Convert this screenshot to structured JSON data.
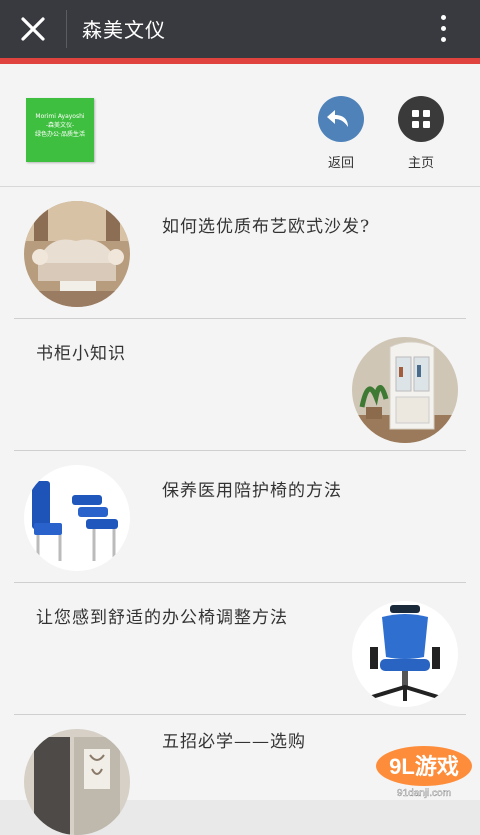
{
  "topbar": {
    "title": "森美文仪",
    "close_icon": "close-icon",
    "more_icon": "more-vertical-icon"
  },
  "header": {
    "logo": {
      "line1": "Morimi Ayayoshi",
      "line2": "-森美文仪-",
      "line3": "绿色办公·品质生活",
      "color": "#3fbf3f"
    },
    "back_label": "返回",
    "home_label": "主页",
    "back_icon": "back-arrow-icon",
    "home_icon": "grid-icon"
  },
  "articles": [
    {
      "title": "如何选优质布艺欧式沙发?",
      "image": "sofa-image"
    },
    {
      "title": "书柜小知识",
      "image": "bookcase-image"
    },
    {
      "title": "保养医用陪护椅的方法",
      "image": "medical-chair-image"
    },
    {
      "title": "让您感到舒适的办公椅调整方法",
      "image": "office-chair-image"
    },
    {
      "title": "五招必学——选购",
      "image": "wardrobe-image"
    }
  ],
  "watermark": {
    "logo_text": "9L游戏",
    "site": "91danji.com"
  },
  "colors": {
    "topbar": "#393a3f",
    "accent_red": "#e0433d",
    "back_button": "#4e82b9",
    "home_button": "#3a3a3a"
  }
}
